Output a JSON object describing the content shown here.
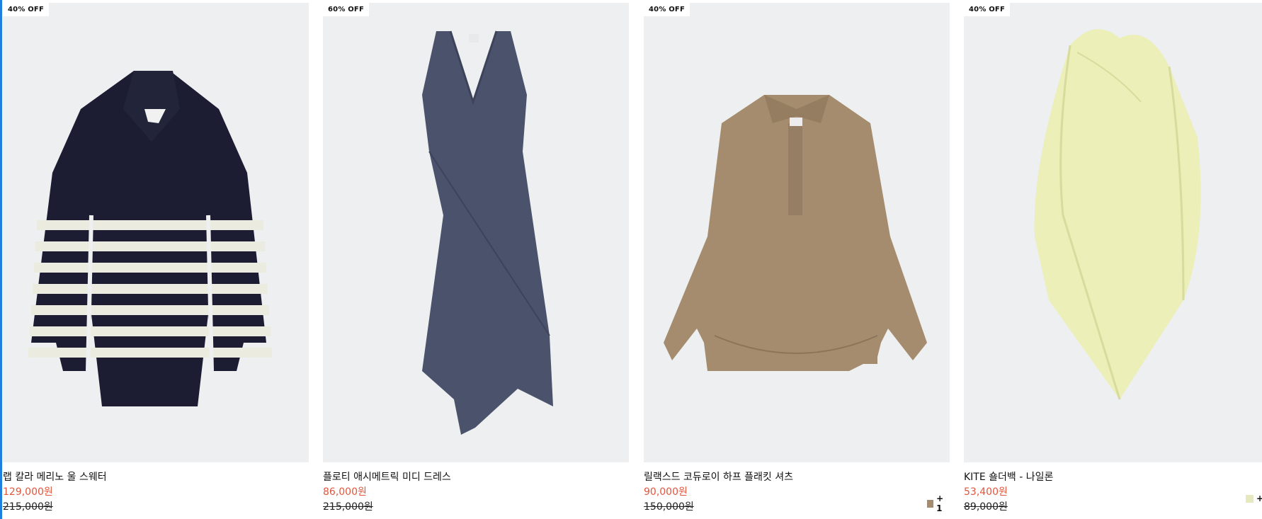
{
  "products": [
    {
      "badge": "40% OFF",
      "name": "랩 칼라 메리노 울 스웨터",
      "price": "129,000원",
      "original_price": "215,000원",
      "image": "navy-striped-sweater",
      "colors": {
        "primary": "#1c1d33",
        "stripe": "#ecebdf"
      }
    },
    {
      "badge": "60% OFF",
      "name": "플로티 애시메트릭 미디 드레스",
      "price": "86,000원",
      "original_price": "215,000원",
      "image": "navy-asymmetric-dress",
      "colors": {
        "primary": "#4a526c"
      }
    },
    {
      "badge": "40% OFF",
      "name": "릴랙스드 코듀로이 하프 플래킷 셔츠",
      "price": "90,000원",
      "original_price": "150,000원",
      "image": "beige-corduroy-shirt",
      "colors": {
        "primary": "#a58c6e"
      },
      "swatch_color": "#a58c6e",
      "more_colors": "+ 1"
    },
    {
      "badge": "40% OFF",
      "name": "KITE 숄더백 - 나일론",
      "price": "53,400원",
      "original_price": "89,000원",
      "image": "yellow-nylon-shoulder-bag",
      "colors": {
        "primary": "#ecefb8"
      },
      "swatch_color": "#e6e8bd",
      "more_colors": "+"
    }
  ],
  "accent_colors": {
    "sale_price": "#e2563c",
    "image_bg": "#edeff0"
  }
}
